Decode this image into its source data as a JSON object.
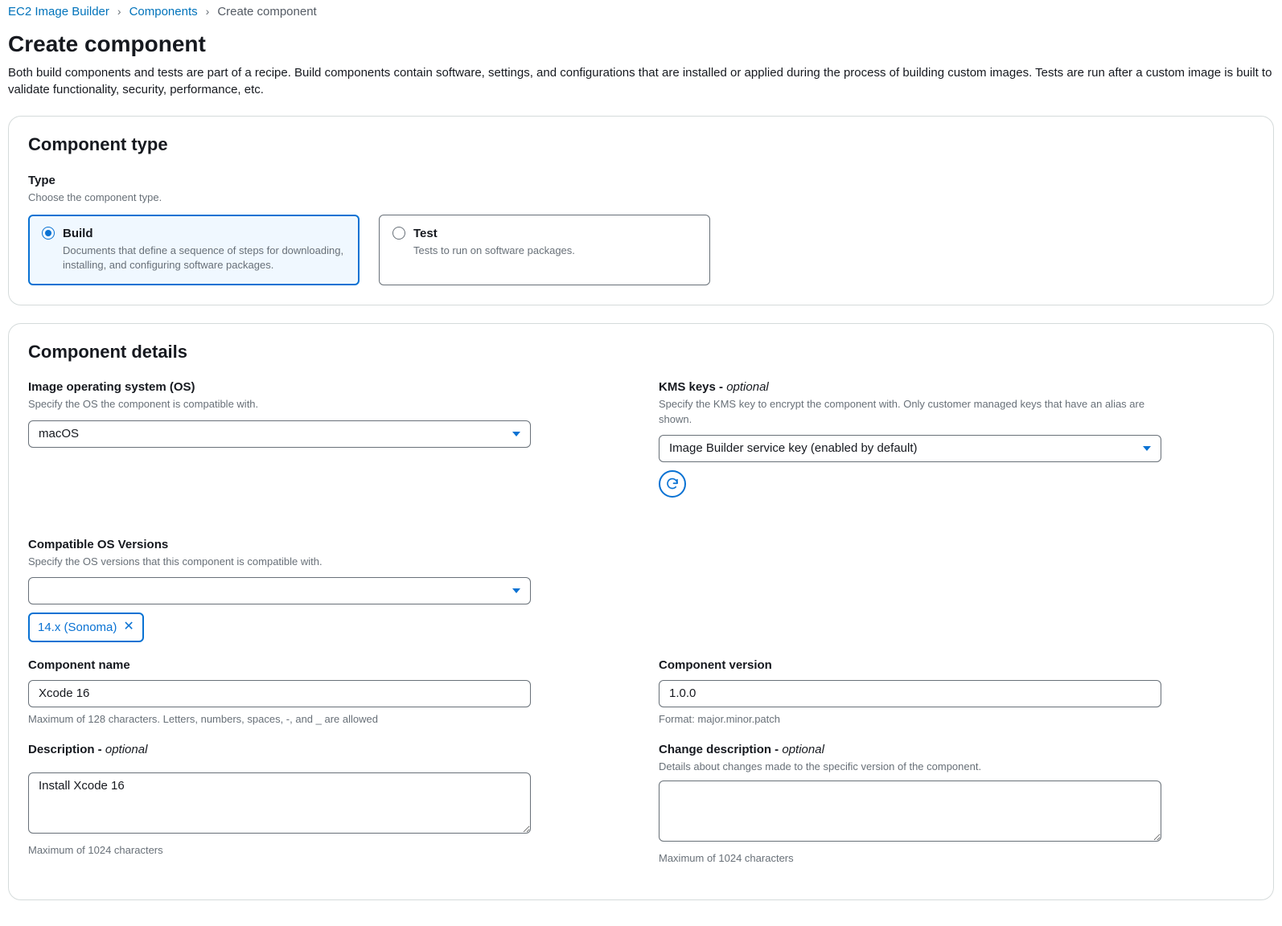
{
  "breadcrumb": {
    "items": [
      "EC2 Image Builder",
      "Components",
      "Create component"
    ]
  },
  "header": {
    "title": "Create component",
    "description": "Both build components and tests are part of a recipe. Build components contain software, settings, and configurations that are installed or applied during the process of building custom images. Tests are run after a custom image is built to validate functionality, security, performance, etc."
  },
  "type_panel": {
    "title": "Component type",
    "field_label": "Type",
    "field_hint": "Choose the component type.",
    "options": {
      "build": {
        "title": "Build",
        "desc": "Documents that define a sequence of steps for downloading, installing, and configuring software packages."
      },
      "test": {
        "title": "Test",
        "desc": "Tests to run on software packages."
      }
    }
  },
  "details_panel": {
    "title": "Component details",
    "os": {
      "label": "Image operating system (OS)",
      "hint": "Specify the OS the component is compatible with.",
      "value": "macOS"
    },
    "kms": {
      "label_prefix": "KMS keys - ",
      "label_optional": "optional",
      "hint": "Specify the KMS key to encrypt the component with. Only customer managed keys that have an alias are shown.",
      "value": "Image Builder service key (enabled by default)"
    },
    "os_versions": {
      "label": "Compatible OS Versions",
      "hint": "Specify the OS versions that this component is compatible with.",
      "value": "",
      "chip": "14.x (Sonoma)"
    },
    "name": {
      "label": "Component name",
      "value": "Xcode 16",
      "help": "Maximum of 128 characters. Letters, numbers, spaces, -, and _ are allowed"
    },
    "version": {
      "label": "Component version",
      "value": "1.0.0",
      "help": "Format: major.minor.patch"
    },
    "description": {
      "label_prefix": "Description - ",
      "label_optional": "optional",
      "value": "Install Xcode 16",
      "help": "Maximum of 1024 characters"
    },
    "change_desc": {
      "label_prefix": "Change description - ",
      "label_optional": "optional",
      "hint": "Details about changes made to the specific version of the component.",
      "value": "",
      "help": "Maximum of 1024 characters"
    }
  }
}
